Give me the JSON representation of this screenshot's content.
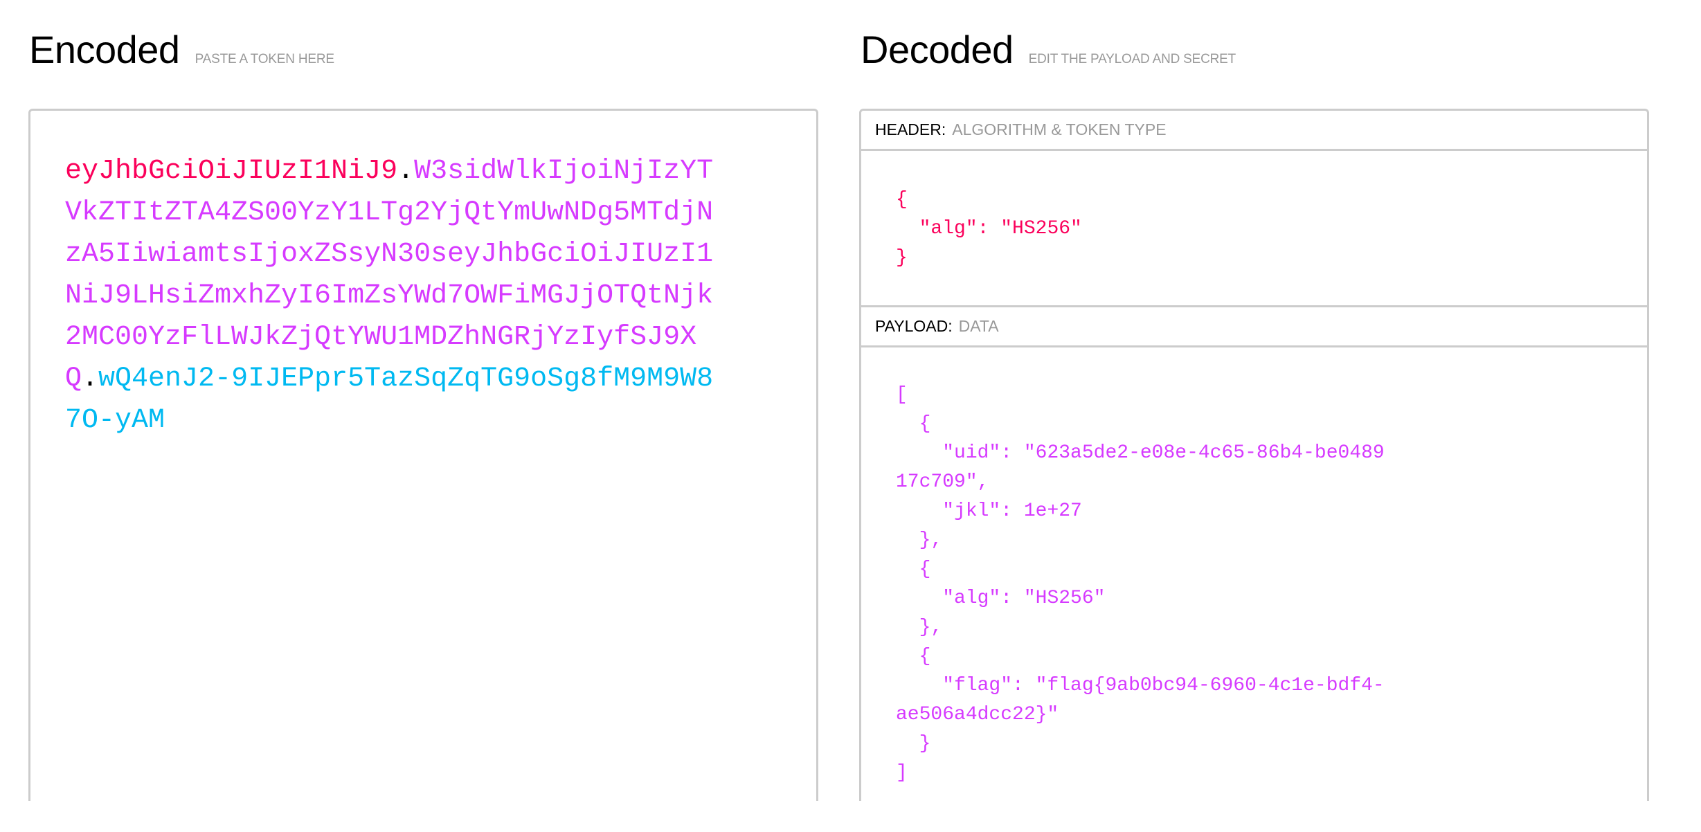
{
  "encoded": {
    "title": "Encoded",
    "subtitle": "PASTE A TOKEN HERE",
    "token": {
      "header": "eyJhbGciOiJIUzI1NiJ9",
      "dot1": ".",
      "payload": "W3sidWlkIjoiNjIzYTVkZTItZTA4ZS00YzY1LTg2YjQtYmUwNDg5MTdjNzA5IiwiamtsIjoxZSsyN30seyJhbGciOiJIUzI1NiJ9LHsiZmxhZyI6ImZsYWd7OWFiMGJjOTQtNjk2MC00YzFlLWJkZjQtYWU1MDZhNGRjYzIyfSJ9XQ",
      "dot2": ".",
      "signature": "wQ4enJ2-9IJEPpr5TazSqZqTG9oSg8fM9M9W87O-yAM"
    }
  },
  "decoded": {
    "title": "Decoded",
    "subtitle": "EDIT THE PAYLOAD AND SECRET",
    "header_section": {
      "label": "HEADER:",
      "sublabel": "ALGORITHM & TOKEN TYPE",
      "json_text": "{\n  \"alg\": \"HS256\"\n}"
    },
    "payload_section": {
      "label": "PAYLOAD:",
      "sublabel": "DATA",
      "json_text": "[\n  {\n    \"uid\": \"623a5de2-e08e-4c65-86b4-be048917c709\",\n    \"jkl\": 1e+27\n  },\n  {\n    \"alg\": \"HS256\"\n  },\n  {\n    \"flag\": \"flag{9ab0bc94-6960-4c1e-bdf4-ae506a4dcc22}\"\n  }\n]"
    }
  },
  "colors": {
    "header": "#fb015b",
    "payload": "#d63aff",
    "signature": "#00b9f1",
    "muted": "#999999",
    "border": "#cccccc"
  }
}
